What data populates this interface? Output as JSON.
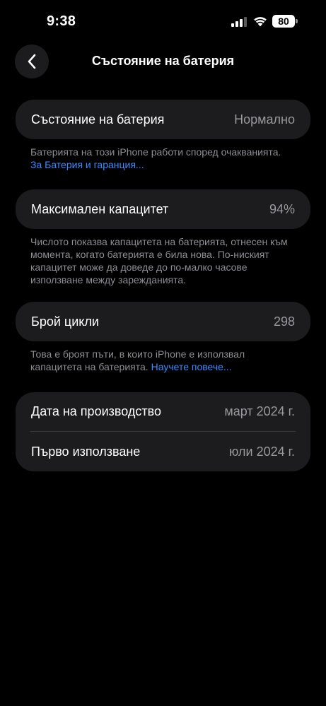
{
  "status_bar": {
    "time": "9:38",
    "battery_level": "80"
  },
  "nav": {
    "title": "Състояние на батерия"
  },
  "battery_health": {
    "label": "Състояние на батерия",
    "value": "Нормално",
    "footnote_text": "Батерията на този iPhone работи според очакванията. ",
    "footnote_link": "За Батерия и гаранция..."
  },
  "max_capacity": {
    "label": "Максимален капацитет",
    "value": "94%",
    "footnote_text": "Числото показва капацитета на батерията, отнесен към момента, когато батерията е била нова. По-ниският капацитет може да доведе до по-малко часове използване между зарежданията."
  },
  "cycle_count": {
    "label": "Брой цикли",
    "value": "298",
    "footnote_text": "Това е броят пъти, в които iPhone е използвал капацитета на батерията. ",
    "footnote_link": "Научете повече..."
  },
  "dates": {
    "manufacture_label": "Дата на производство",
    "manufacture_value": "март 2024 г.",
    "first_use_label": "Първо използване",
    "first_use_value": "юли 2024 г."
  },
  "colors": {
    "background": "#000000",
    "card": "#1c1c1e",
    "secondary_text": "#98989f",
    "link": "#3a8bff"
  }
}
